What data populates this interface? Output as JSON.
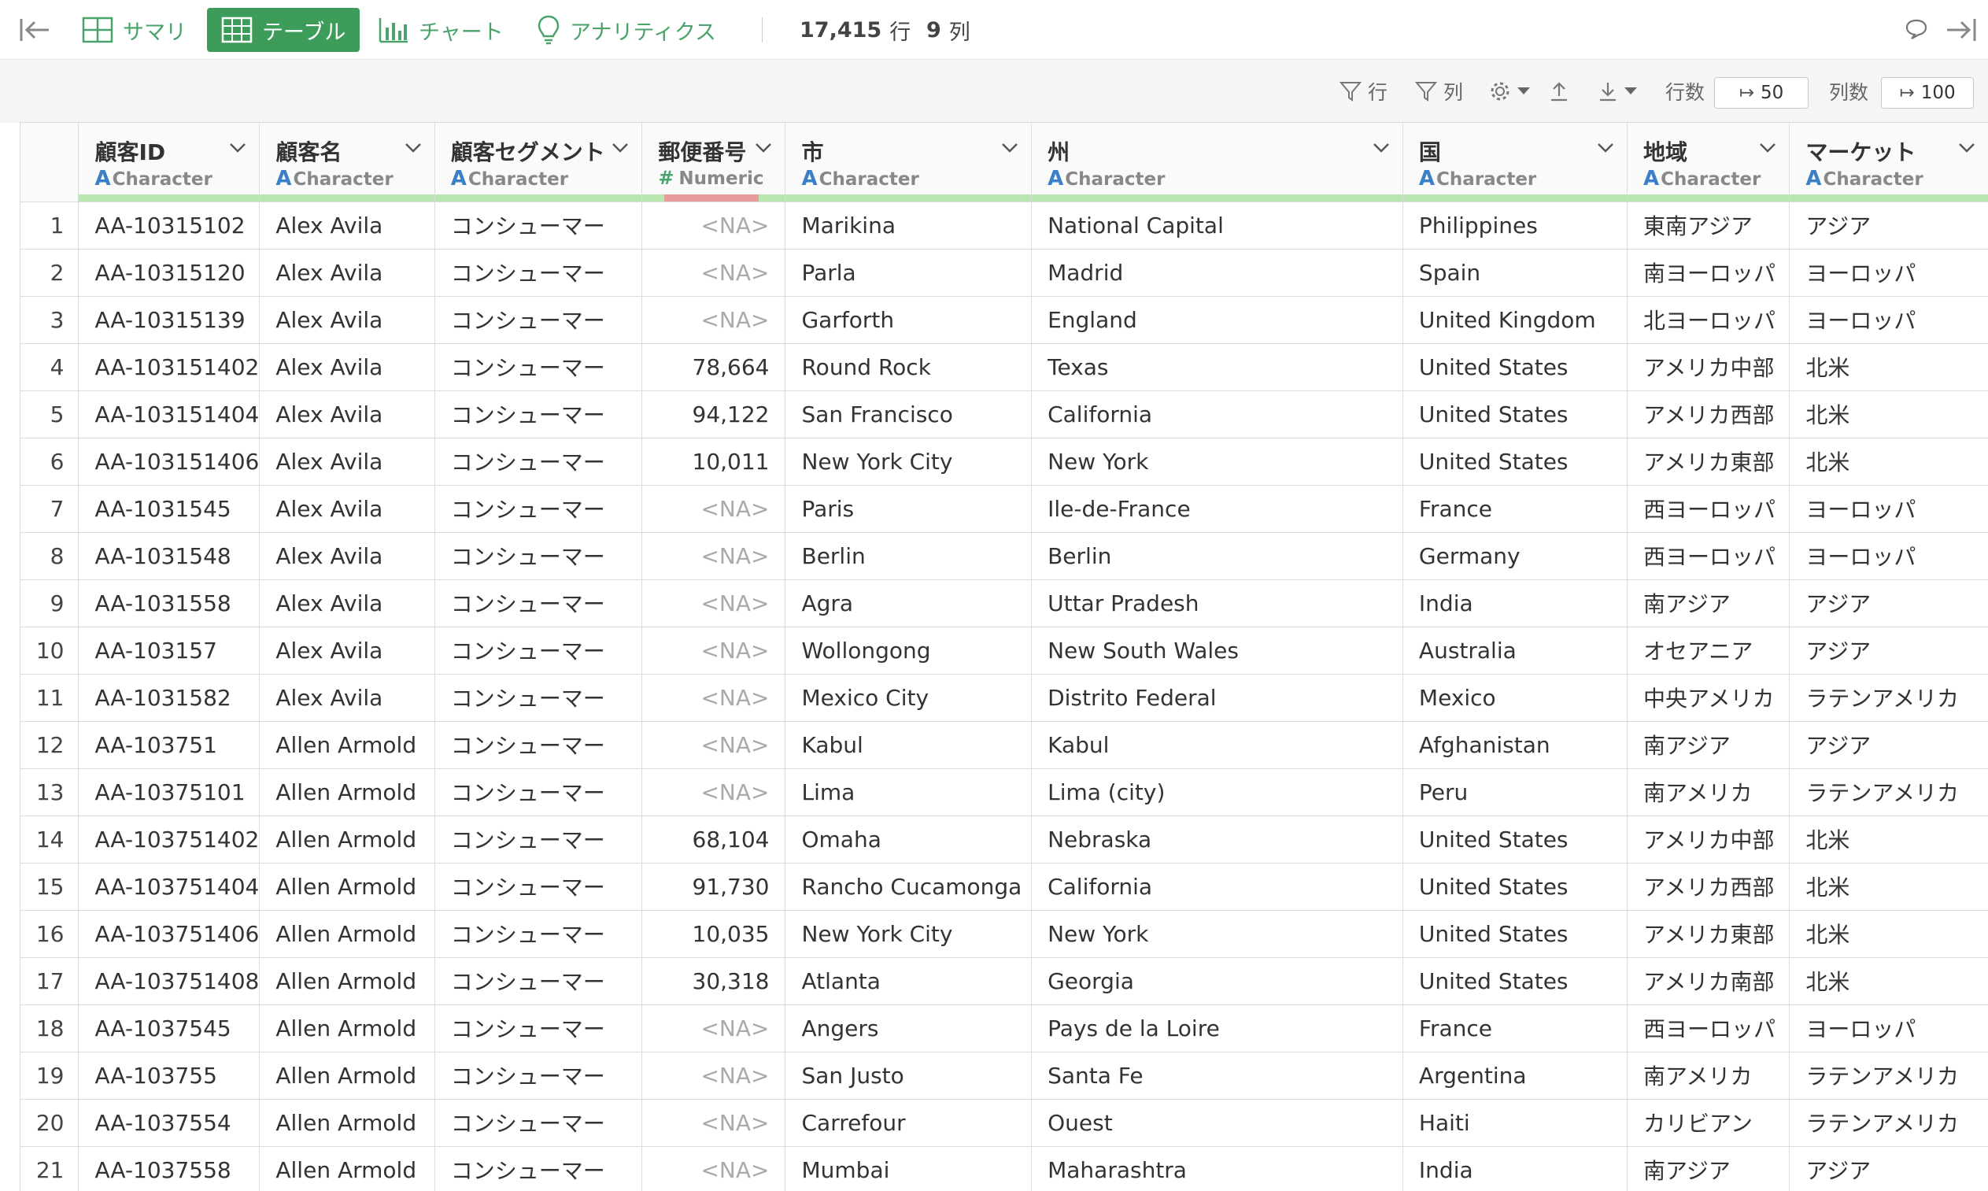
{
  "toolbar": {
    "tabs": [
      {
        "label": "サマリ"
      },
      {
        "label": "テーブル",
        "active": true
      },
      {
        "label": "チャート"
      },
      {
        "label": "アナリティクス"
      }
    ],
    "row_count": "17,415",
    "row_unit": "行",
    "col_count": "9",
    "col_unit": "列"
  },
  "subbar": {
    "row_filter": "行",
    "col_filter": "列",
    "rows_label": "行数",
    "rows_value": "50",
    "cols_label": "列数",
    "cols_value": "100"
  },
  "columns": [
    {
      "name": "顧客ID",
      "type": "Character"
    },
    {
      "name": "顧客名",
      "type": "Character"
    },
    {
      "name": "顧客セグメント",
      "type": "Character"
    },
    {
      "name": "郵便番号",
      "type": "Numeric"
    },
    {
      "name": "市",
      "type": "Character"
    },
    {
      "name": "州",
      "type": "Character"
    },
    {
      "name": "国",
      "type": "Character"
    },
    {
      "name": "地域",
      "type": "Character"
    },
    {
      "name": "マーケット",
      "type": "Character"
    }
  ],
  "rows": [
    {
      "n": "1",
      "id": "AA-10315102",
      "name": "Alex Avila",
      "seg": "コンシューマー",
      "zip": "<NA>",
      "city": "Marikina",
      "state": "National Capital",
      "country": "Philippines",
      "region": "東南アジア",
      "market": "アジア"
    },
    {
      "n": "2",
      "id": "AA-10315120",
      "name": "Alex Avila",
      "seg": "コンシューマー",
      "zip": "<NA>",
      "city": "Parla",
      "state": "Madrid",
      "country": "Spain",
      "region": "南ヨーロッパ",
      "market": "ヨーロッパ"
    },
    {
      "n": "3",
      "id": "AA-10315139",
      "name": "Alex Avila",
      "seg": "コンシューマー",
      "zip": "<NA>",
      "city": "Garforth",
      "state": "England",
      "country": "United Kingdom",
      "region": "北ヨーロッパ",
      "market": "ヨーロッパ"
    },
    {
      "n": "4",
      "id": "AA-103151402",
      "name": "Alex Avila",
      "seg": "コンシューマー",
      "zip": "78,664",
      "city": "Round Rock",
      "state": "Texas",
      "country": "United States",
      "region": "アメリカ中部",
      "market": "北米"
    },
    {
      "n": "5",
      "id": "AA-103151404",
      "name": "Alex Avila",
      "seg": "コンシューマー",
      "zip": "94,122",
      "city": "San Francisco",
      "state": "California",
      "country": "United States",
      "region": "アメリカ西部",
      "market": "北米"
    },
    {
      "n": "6",
      "id": "AA-103151406",
      "name": "Alex Avila",
      "seg": "コンシューマー",
      "zip": "10,011",
      "city": "New York City",
      "state": "New York",
      "country": "United States",
      "region": "アメリカ東部",
      "market": "北米"
    },
    {
      "n": "7",
      "id": "AA-1031545",
      "name": "Alex Avila",
      "seg": "コンシューマー",
      "zip": "<NA>",
      "city": "Paris",
      "state": "Ile-de-France",
      "country": "France",
      "region": "西ヨーロッパ",
      "market": "ヨーロッパ"
    },
    {
      "n": "8",
      "id": "AA-1031548",
      "name": "Alex Avila",
      "seg": "コンシューマー",
      "zip": "<NA>",
      "city": "Berlin",
      "state": "Berlin",
      "country": "Germany",
      "region": "西ヨーロッパ",
      "market": "ヨーロッパ"
    },
    {
      "n": "9",
      "id": "AA-1031558",
      "name": "Alex Avila",
      "seg": "コンシューマー",
      "zip": "<NA>",
      "city": "Agra",
      "state": "Uttar Pradesh",
      "country": "India",
      "region": "南アジア",
      "market": "アジア"
    },
    {
      "n": "10",
      "id": "AA-103157",
      "name": "Alex Avila",
      "seg": "コンシューマー",
      "zip": "<NA>",
      "city": "Wollongong",
      "state": "New South Wales",
      "country": "Australia",
      "region": "オセアニア",
      "market": "アジア"
    },
    {
      "n": "11",
      "id": "AA-1031582",
      "name": "Alex Avila",
      "seg": "コンシューマー",
      "zip": "<NA>",
      "city": "Mexico City",
      "state": "Distrito Federal",
      "country": "Mexico",
      "region": "中央アメリカ",
      "market": "ラテンアメリカ"
    },
    {
      "n": "12",
      "id": "AA-103751",
      "name": "Allen Armold",
      "seg": "コンシューマー",
      "zip": "<NA>",
      "city": "Kabul",
      "state": "Kabul",
      "country": "Afghanistan",
      "region": "南アジア",
      "market": "アジア"
    },
    {
      "n": "13",
      "id": "AA-10375101",
      "name": "Allen Armold",
      "seg": "コンシューマー",
      "zip": "<NA>",
      "city": "Lima",
      "state": "Lima (city)",
      "country": "Peru",
      "region": "南アメリカ",
      "market": "ラテンアメリカ"
    },
    {
      "n": "14",
      "id": "AA-103751402",
      "name": "Allen Armold",
      "seg": "コンシューマー",
      "zip": "68,104",
      "city": "Omaha",
      "state": "Nebraska",
      "country": "United States",
      "region": "アメリカ中部",
      "market": "北米"
    },
    {
      "n": "15",
      "id": "AA-103751404",
      "name": "Allen Armold",
      "seg": "コンシューマー",
      "zip": "91,730",
      "city": "Rancho Cucamonga",
      "state": "California",
      "country": "United States",
      "region": "アメリカ西部",
      "market": "北米"
    },
    {
      "n": "16",
      "id": "AA-103751406",
      "name": "Allen Armold",
      "seg": "コンシューマー",
      "zip": "10,035",
      "city": "New York City",
      "state": "New York",
      "country": "United States",
      "region": "アメリカ東部",
      "market": "北米"
    },
    {
      "n": "17",
      "id": "AA-103751408",
      "name": "Allen Armold",
      "seg": "コンシューマー",
      "zip": "30,318",
      "city": "Atlanta",
      "state": "Georgia",
      "country": "United States",
      "region": "アメリカ南部",
      "market": "北米"
    },
    {
      "n": "18",
      "id": "AA-1037545",
      "name": "Allen Armold",
      "seg": "コンシューマー",
      "zip": "<NA>",
      "city": "Angers",
      "state": "Pays de la Loire",
      "country": "France",
      "region": "西ヨーロッパ",
      "market": "ヨーロッパ"
    },
    {
      "n": "19",
      "id": "AA-103755",
      "name": "Allen Armold",
      "seg": "コンシューマー",
      "zip": "<NA>",
      "city": "San Justo",
      "state": "Santa Fe",
      "country": "Argentina",
      "region": "南アメリカ",
      "market": "ラテンアメリカ"
    },
    {
      "n": "20",
      "id": "AA-1037554",
      "name": "Allen Armold",
      "seg": "コンシューマー",
      "zip": "<NA>",
      "city": "Carrefour",
      "state": "Ouest",
      "country": "Haiti",
      "region": "カリビアン",
      "market": "ラテンアメリカ"
    },
    {
      "n": "21",
      "id": "AA-1037558",
      "name": "Allen Armold",
      "seg": "コンシューマー",
      "zip": "<NA>",
      "city": "Mumbai",
      "state": "Maharashtra",
      "country": "India",
      "region": "南アジア",
      "market": "アジア"
    }
  ]
}
